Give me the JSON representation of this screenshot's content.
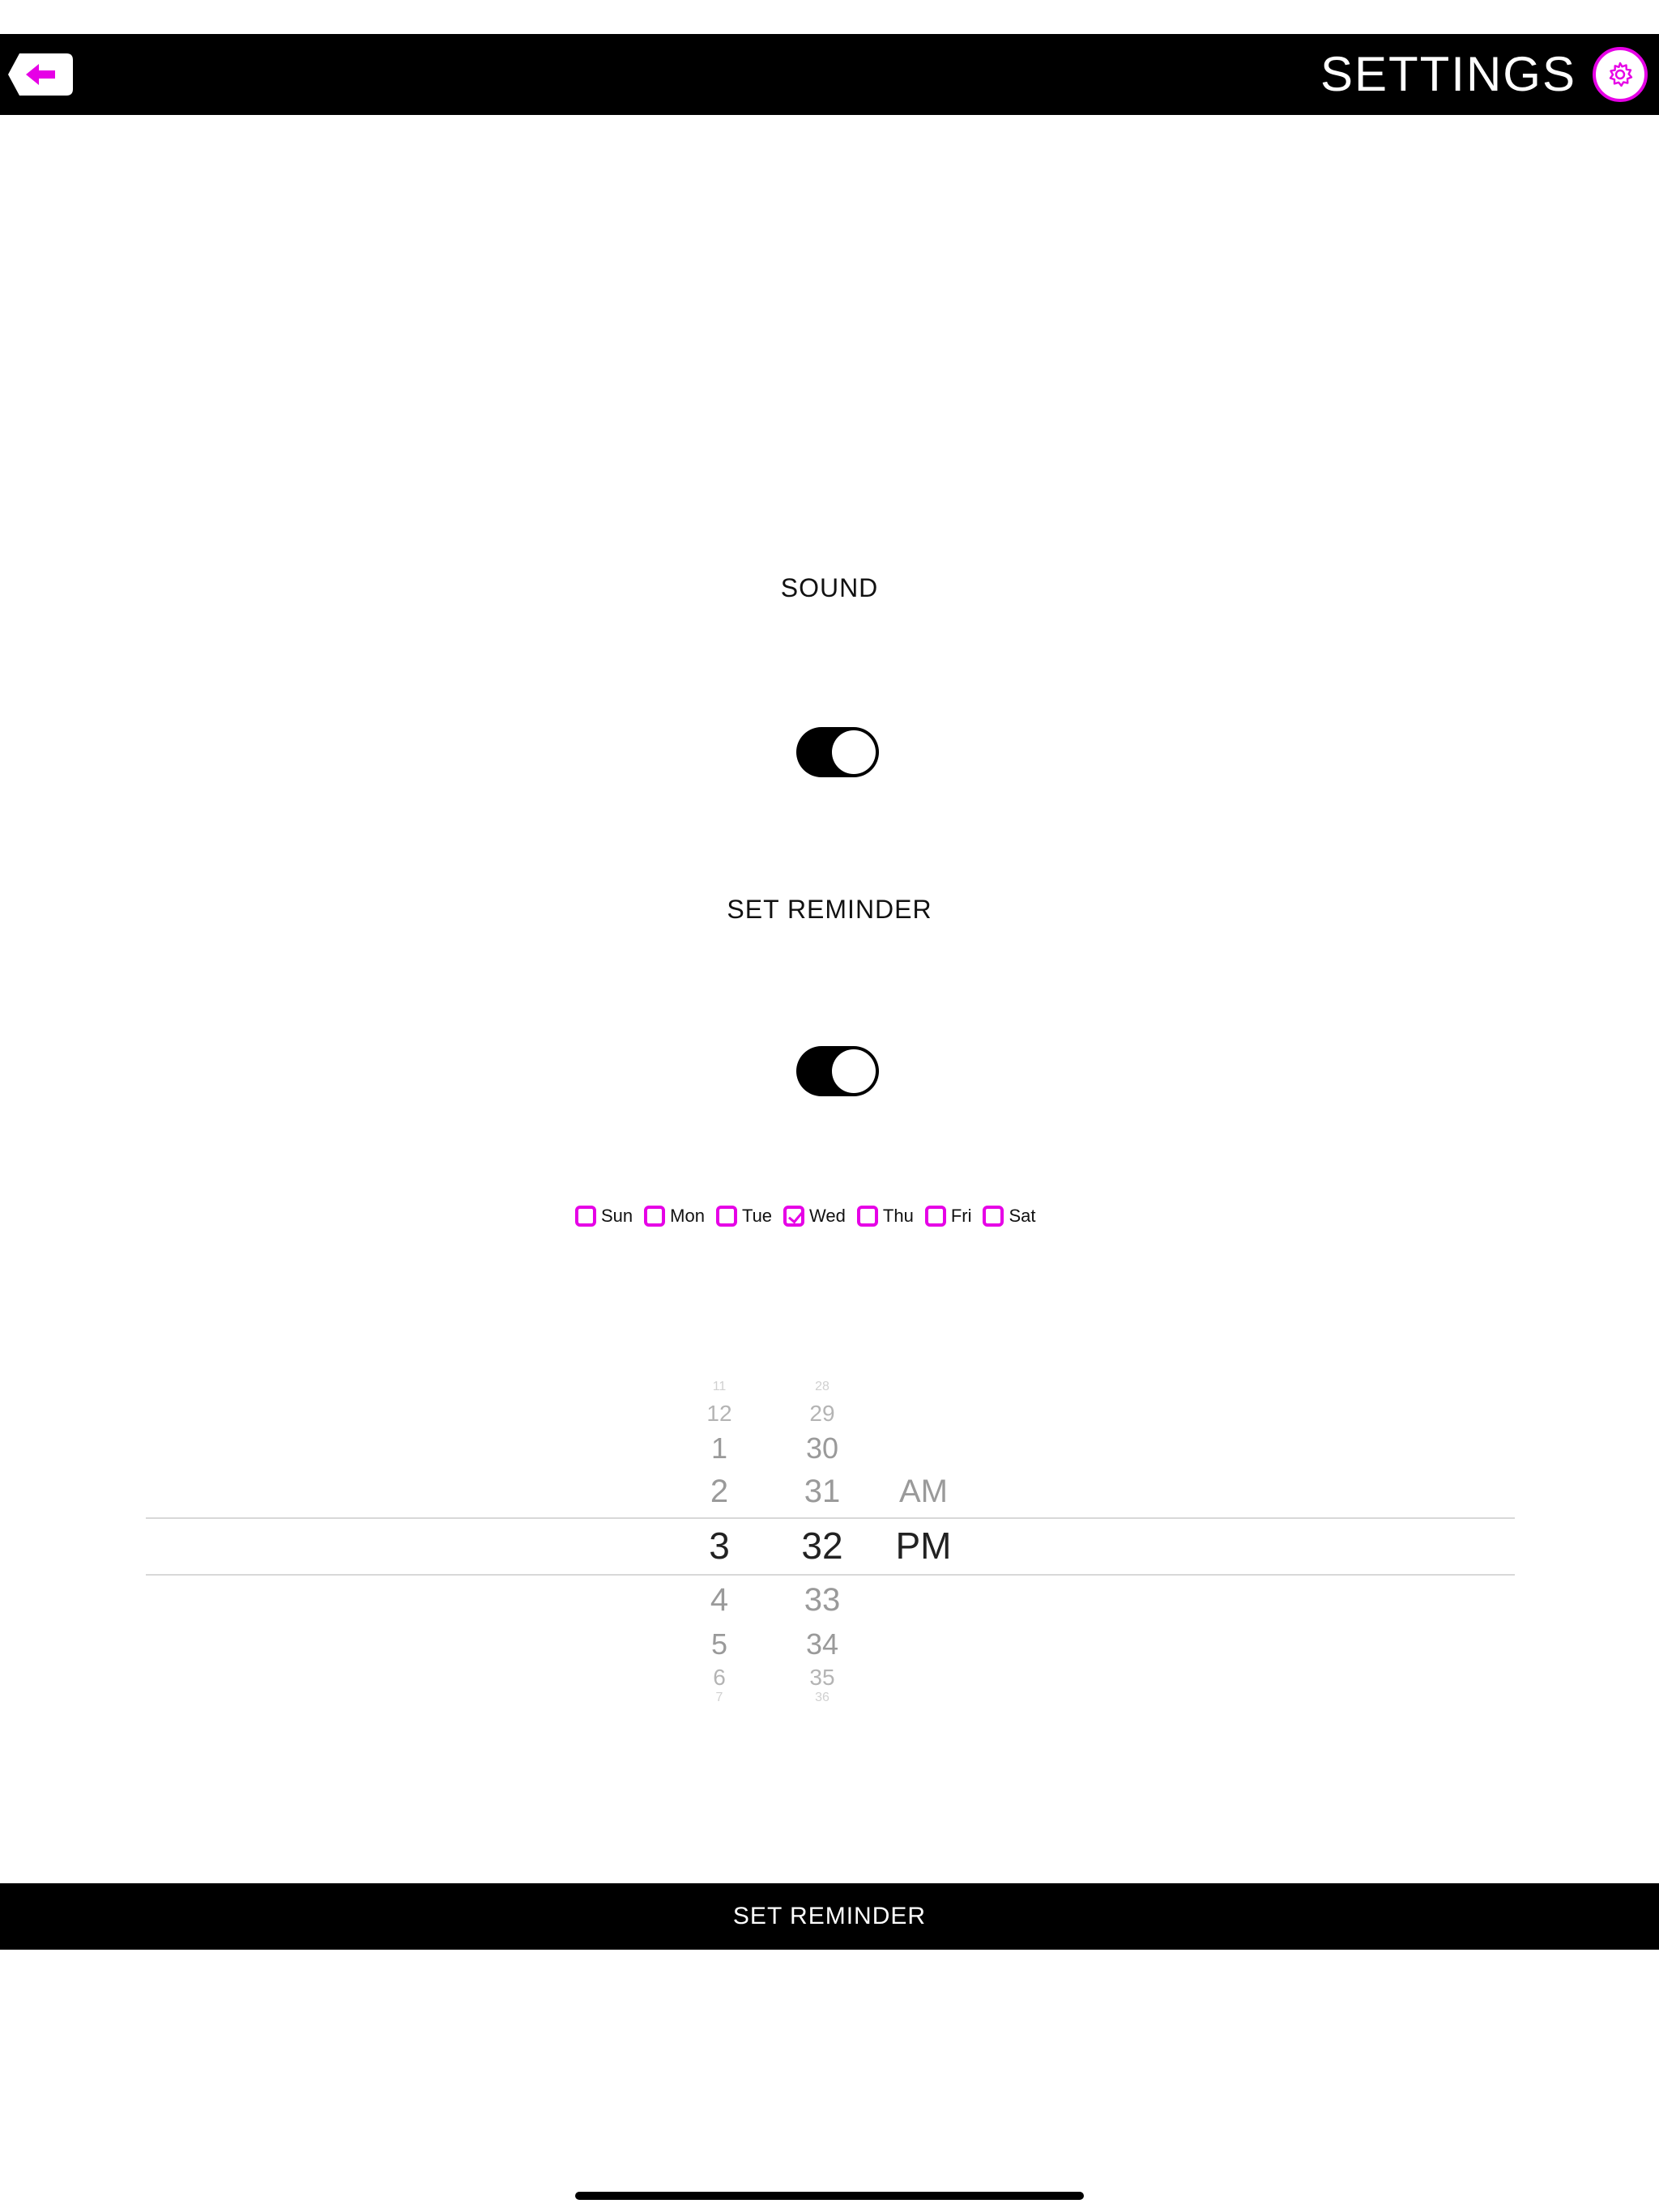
{
  "header": {
    "title": "SETTINGS",
    "back_icon": "arrow-left-icon",
    "settings_icon": "gear-icon"
  },
  "sound": {
    "label": "SOUND",
    "enabled": true
  },
  "reminder": {
    "label": "SET REMINDER",
    "enabled": true
  },
  "days": [
    {
      "label": "Sun",
      "checked": false
    },
    {
      "label": "Mon",
      "checked": false
    },
    {
      "label": "Tue",
      "checked": false
    },
    {
      "label": "Wed",
      "checked": true
    },
    {
      "label": "Thu",
      "checked": false
    },
    {
      "label": "Fri",
      "checked": false
    },
    {
      "label": "Sat",
      "checked": false
    }
  ],
  "time_picker": {
    "hours": [
      "11",
      "12",
      "1",
      "2",
      "3",
      "4",
      "5",
      "6",
      "7"
    ],
    "minutes": [
      "28",
      "29",
      "30",
      "31",
      "32",
      "33",
      "34",
      "35",
      "36"
    ],
    "periods": [
      "AM",
      "PM"
    ],
    "selected_hour": "3",
    "selected_minute": "32",
    "selected_period": "PM"
  },
  "footer": {
    "button_label": "SET REMINDER"
  },
  "colors": {
    "accent": "#e600e6",
    "bar": "#000000"
  }
}
